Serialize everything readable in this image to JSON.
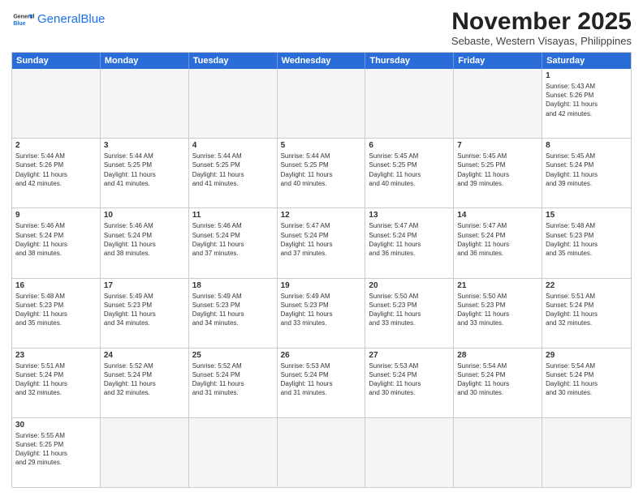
{
  "header": {
    "logo_general": "General",
    "logo_blue": "Blue",
    "month_title": "November 2025",
    "subtitle": "Sebaste, Western Visayas, Philippines"
  },
  "weekdays": [
    "Sunday",
    "Monday",
    "Tuesday",
    "Wednesday",
    "Thursday",
    "Friday",
    "Saturday"
  ],
  "rows": [
    [
      {
        "day": "",
        "text": "",
        "empty": true
      },
      {
        "day": "",
        "text": "",
        "empty": true
      },
      {
        "day": "",
        "text": "",
        "empty": true
      },
      {
        "day": "",
        "text": "",
        "empty": true
      },
      {
        "day": "",
        "text": "",
        "empty": true
      },
      {
        "day": "",
        "text": "",
        "empty": true
      },
      {
        "day": "1",
        "text": "Sunrise: 5:43 AM\nSunset: 5:26 PM\nDaylight: 11 hours\nand 42 minutes.",
        "empty": false
      }
    ],
    [
      {
        "day": "2",
        "text": "Sunrise: 5:44 AM\nSunset: 5:26 PM\nDaylight: 11 hours\nand 42 minutes.",
        "empty": false
      },
      {
        "day": "3",
        "text": "Sunrise: 5:44 AM\nSunset: 5:25 PM\nDaylight: 11 hours\nand 41 minutes.",
        "empty": false
      },
      {
        "day": "4",
        "text": "Sunrise: 5:44 AM\nSunset: 5:25 PM\nDaylight: 11 hours\nand 41 minutes.",
        "empty": false
      },
      {
        "day": "5",
        "text": "Sunrise: 5:44 AM\nSunset: 5:25 PM\nDaylight: 11 hours\nand 40 minutes.",
        "empty": false
      },
      {
        "day": "6",
        "text": "Sunrise: 5:45 AM\nSunset: 5:25 PM\nDaylight: 11 hours\nand 40 minutes.",
        "empty": false
      },
      {
        "day": "7",
        "text": "Sunrise: 5:45 AM\nSunset: 5:25 PM\nDaylight: 11 hours\nand 39 minutes.",
        "empty": false
      },
      {
        "day": "8",
        "text": "Sunrise: 5:45 AM\nSunset: 5:24 PM\nDaylight: 11 hours\nand 39 minutes.",
        "empty": false
      }
    ],
    [
      {
        "day": "9",
        "text": "Sunrise: 5:46 AM\nSunset: 5:24 PM\nDaylight: 11 hours\nand 38 minutes.",
        "empty": false
      },
      {
        "day": "10",
        "text": "Sunrise: 5:46 AM\nSunset: 5:24 PM\nDaylight: 11 hours\nand 38 minutes.",
        "empty": false
      },
      {
        "day": "11",
        "text": "Sunrise: 5:46 AM\nSunset: 5:24 PM\nDaylight: 11 hours\nand 37 minutes.",
        "empty": false
      },
      {
        "day": "12",
        "text": "Sunrise: 5:47 AM\nSunset: 5:24 PM\nDaylight: 11 hours\nand 37 minutes.",
        "empty": false
      },
      {
        "day": "13",
        "text": "Sunrise: 5:47 AM\nSunset: 5:24 PM\nDaylight: 11 hours\nand 36 minutes.",
        "empty": false
      },
      {
        "day": "14",
        "text": "Sunrise: 5:47 AM\nSunset: 5:24 PM\nDaylight: 11 hours\nand 36 minutes.",
        "empty": false
      },
      {
        "day": "15",
        "text": "Sunrise: 5:48 AM\nSunset: 5:23 PM\nDaylight: 11 hours\nand 35 minutes.",
        "empty": false
      }
    ],
    [
      {
        "day": "16",
        "text": "Sunrise: 5:48 AM\nSunset: 5:23 PM\nDaylight: 11 hours\nand 35 minutes.",
        "empty": false
      },
      {
        "day": "17",
        "text": "Sunrise: 5:49 AM\nSunset: 5:23 PM\nDaylight: 11 hours\nand 34 minutes.",
        "empty": false
      },
      {
        "day": "18",
        "text": "Sunrise: 5:49 AM\nSunset: 5:23 PM\nDaylight: 11 hours\nand 34 minutes.",
        "empty": false
      },
      {
        "day": "19",
        "text": "Sunrise: 5:49 AM\nSunset: 5:23 PM\nDaylight: 11 hours\nand 33 minutes.",
        "empty": false
      },
      {
        "day": "20",
        "text": "Sunrise: 5:50 AM\nSunset: 5:23 PM\nDaylight: 11 hours\nand 33 minutes.",
        "empty": false
      },
      {
        "day": "21",
        "text": "Sunrise: 5:50 AM\nSunset: 5:23 PM\nDaylight: 11 hours\nand 33 minutes.",
        "empty": false
      },
      {
        "day": "22",
        "text": "Sunrise: 5:51 AM\nSunset: 5:24 PM\nDaylight: 11 hours\nand 32 minutes.",
        "empty": false
      }
    ],
    [
      {
        "day": "23",
        "text": "Sunrise: 5:51 AM\nSunset: 5:24 PM\nDaylight: 11 hours\nand 32 minutes.",
        "empty": false
      },
      {
        "day": "24",
        "text": "Sunrise: 5:52 AM\nSunset: 5:24 PM\nDaylight: 11 hours\nand 32 minutes.",
        "empty": false
      },
      {
        "day": "25",
        "text": "Sunrise: 5:52 AM\nSunset: 5:24 PM\nDaylight: 11 hours\nand 31 minutes.",
        "empty": false
      },
      {
        "day": "26",
        "text": "Sunrise: 5:53 AM\nSunset: 5:24 PM\nDaylight: 11 hours\nand 31 minutes.",
        "empty": false
      },
      {
        "day": "27",
        "text": "Sunrise: 5:53 AM\nSunset: 5:24 PM\nDaylight: 11 hours\nand 30 minutes.",
        "empty": false
      },
      {
        "day": "28",
        "text": "Sunrise: 5:54 AM\nSunset: 5:24 PM\nDaylight: 11 hours\nand 30 minutes.",
        "empty": false
      },
      {
        "day": "29",
        "text": "Sunrise: 5:54 AM\nSunset: 5:24 PM\nDaylight: 11 hours\nand 30 minutes.",
        "empty": false
      }
    ],
    [
      {
        "day": "30",
        "text": "Sunrise: 5:55 AM\nSunset: 5:25 PM\nDaylight: 11 hours\nand 29 minutes.",
        "empty": false
      },
      {
        "day": "",
        "text": "",
        "empty": true
      },
      {
        "day": "",
        "text": "",
        "empty": true
      },
      {
        "day": "",
        "text": "",
        "empty": true
      },
      {
        "day": "",
        "text": "",
        "empty": true
      },
      {
        "day": "",
        "text": "",
        "empty": true
      },
      {
        "day": "",
        "text": "",
        "empty": true
      }
    ]
  ]
}
